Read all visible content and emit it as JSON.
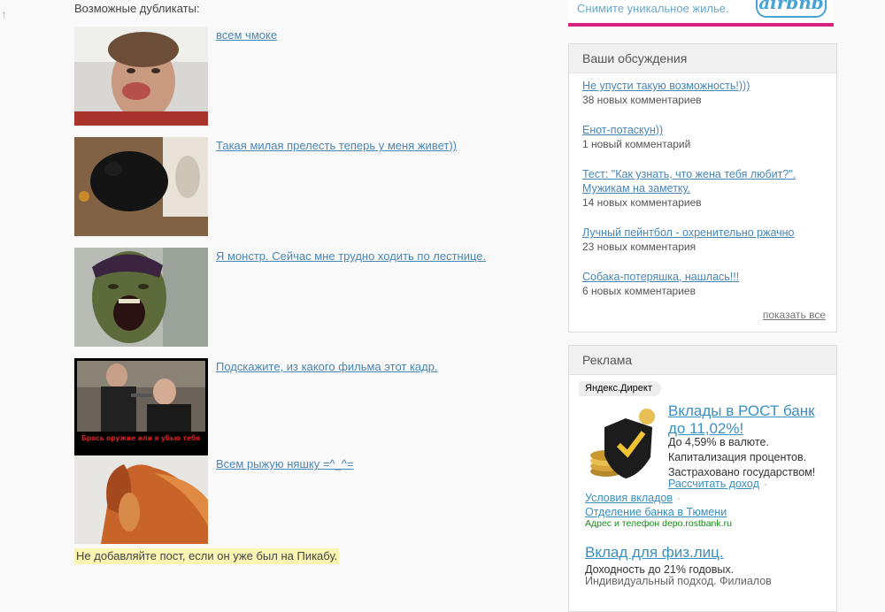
{
  "duplicates": {
    "heading": "Возможные дубликаты:",
    "items": [
      {
        "title": "всем чмоке"
      },
      {
        "title": "Такая милая прелесть теперь у меня живет))"
      },
      {
        "title": "Я монстр. Сейчас мне трудно ходить по лестнице."
      },
      {
        "title": "Подскажите, из какого фильма этот кадр."
      },
      {
        "title": "Всем рыжую няшку =^_^="
      }
    ],
    "thumb4_caption": "Брось оружие или я убью тебя",
    "notice": "Не добавляйте пост, если он уже был на Пикабу."
  },
  "banner": {
    "text": "Снимите уникальное жилье.",
    "logo": "airbnb"
  },
  "discussions": {
    "title": "Ваши обсуждения",
    "items": [
      {
        "title": "Не упусти такую возможность!)))",
        "count": "38 новых комментариев"
      },
      {
        "title": "Енот-потаскун))",
        "count": "1 новый комментарий"
      },
      {
        "title": "Тест: \"Как узнать, что жена тебя любит?\". Мужикам на заметку.",
        "count": "14 новых комментариев"
      },
      {
        "title": "Лучный пейнтбол - охренительно ржачно",
        "count": "23 новых комментария"
      },
      {
        "title": "Собака-потеряшка, нашлась!!!",
        "count": "6 новых комментариев"
      }
    ],
    "show_all": "показать все"
  },
  "ads": {
    "title": "Реклама",
    "badge": "Яндекс.Директ",
    "ad1": {
      "title": "Вклады в РОСТ банк до 11,02%!",
      "text": "До 4,59% в валюте. Капитализация процентов. Застраховано государством!",
      "link_calc": "Рассчитать доход",
      "link_terms": "Условия вкладов",
      "link_branch": "Отделение банка в Тюмени",
      "address_line": "Адрес и телефон  depo.rostbank.ru"
    },
    "ad2": {
      "title": "Вклад для физ.лиц.",
      "text": "Доходность до 21% годовых.",
      "more": "Индивидуальный подход. Филиалов"
    }
  },
  "colors": {
    "link": "#4a86b5",
    "banner_accent": "#d6217f",
    "notice_bg": "#fbf5b4",
    "ad_green": "#1a8a1a"
  }
}
